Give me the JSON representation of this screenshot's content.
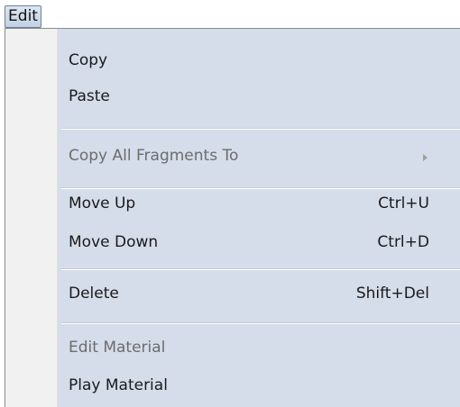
{
  "menubar": {
    "edit_label": "Edit"
  },
  "menu": {
    "copy": "Copy",
    "paste": "Paste",
    "copy_all_fragments_to": "Copy All Fragments To",
    "move_up": "Move Up",
    "move_up_shortcut": "Ctrl+U",
    "move_down": "Move Down",
    "move_down_shortcut": "Ctrl+D",
    "delete": "Delete",
    "delete_shortcut": "Shift+Del",
    "edit_material": "Edit Material",
    "play_material": "Play Material"
  },
  "icons": {
    "submenu": "submenu-arrow-icon"
  },
  "colors": {
    "menu_highlight": "#d5dcea",
    "disabled_text": "#6d6d6d"
  }
}
